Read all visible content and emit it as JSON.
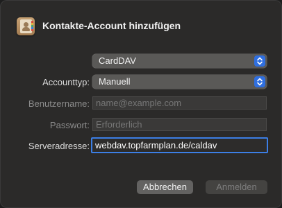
{
  "dialog": {
    "title": "Kontakte-Account hinzufügen",
    "icon": "contacts-app-icon"
  },
  "form": {
    "type_select": {
      "value": "CardDAV"
    },
    "accounttype": {
      "label": "Accounttyp:",
      "value": "Manuell"
    },
    "username": {
      "label": "Benutzername:",
      "placeholder": "name@example.com",
      "value": ""
    },
    "password": {
      "label": "Passwort:",
      "placeholder": "Erforderlich",
      "value": ""
    },
    "server": {
      "label": "Serveradresse:",
      "value": "webdav.topfarmplan.de/caldav"
    }
  },
  "buttons": {
    "cancel": "Abbrechen",
    "login": "Anmelden"
  },
  "colors": {
    "accent": "#2f6fe0",
    "focus_ring": "#3c7fe6",
    "background": "#2b2a29"
  }
}
